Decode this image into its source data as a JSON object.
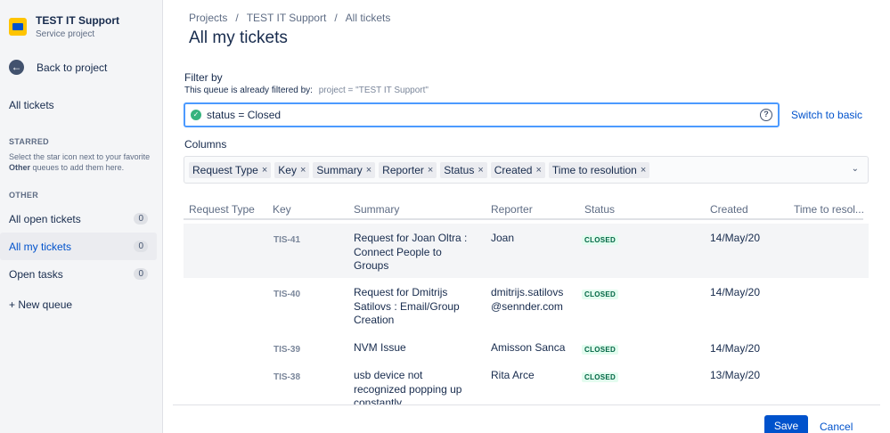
{
  "project": {
    "name": "TEST IT Support",
    "type": "Service project"
  },
  "sidebar": {
    "back_label": "Back to project",
    "all_tickets": "All tickets",
    "starred_heading": "STARRED",
    "starred_help_1": "Select the star icon next to your favorite",
    "starred_help_bold": "Other",
    "starred_help_2": "queues to add them here.",
    "other_heading": "OTHER",
    "queues": [
      {
        "label": "All open tickets",
        "count": "0"
      },
      {
        "label": "All my tickets",
        "count": "0"
      },
      {
        "label": "Open tasks",
        "count": "0"
      }
    ],
    "new_queue": "+ New queue"
  },
  "breadcrumb": [
    "Projects",
    "TEST IT Support",
    "All tickets"
  ],
  "page_title": "All my tickets",
  "filter": {
    "label": "Filter by",
    "prefilter_text": "This queue is already filtered by:",
    "prefilter_code": "project = \"TEST IT Support\"",
    "jql_value": "status = Closed",
    "switch_label": "Switch to basic"
  },
  "columns": {
    "label": "Columns",
    "chips": [
      "Request Type",
      "Key",
      "Summary",
      "Reporter",
      "Status",
      "Created",
      "Time to resolution"
    ]
  },
  "table": {
    "headers": [
      "Request Type",
      "Key",
      "Summary",
      "Reporter",
      "Status",
      "Created",
      "Time to resol..."
    ],
    "rows": [
      {
        "key": "TIS-41",
        "summary": [
          "Request for Joan Oltra :",
          "Connect People to",
          "Groups"
        ],
        "reporter": [
          "Joan"
        ],
        "status": "CLOSED",
        "created": "14/May/20"
      },
      {
        "key": "TIS-40",
        "summary": [
          "Request for Dmitrijs",
          "Satilovs : Email/Group",
          "Creation"
        ],
        "reporter": [
          "dmitrijs.satilovs",
          "@sennder.com"
        ],
        "status": "CLOSED",
        "created": "14/May/20"
      },
      {
        "key": "TIS-39",
        "summary": [
          "NVM Issue"
        ],
        "reporter": [
          "Amisson Sanca"
        ],
        "status": "CLOSED",
        "created": "14/May/20"
      },
      {
        "key": "TIS-38",
        "summary": [
          "usb device not",
          "recognized popping up",
          "constantly"
        ],
        "reporter": [
          "Rita Arce"
        ],
        "status": "CLOSED",
        "created": "13/May/20"
      }
    ]
  },
  "footer": {
    "save_label": "Save",
    "cancel_label": "Cancel"
  },
  "colors": {
    "primary": "#0052CC",
    "focus": "#4C9AFF",
    "success": "#36B37E",
    "lozenge_bg": "#E3FCEF",
    "lozenge_text": "#006644"
  }
}
